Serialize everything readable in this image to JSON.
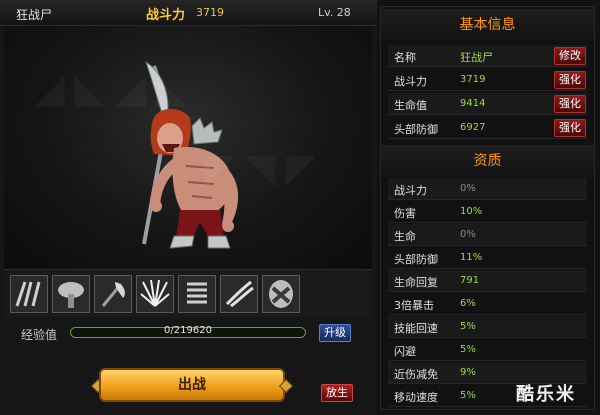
{
  "header": {
    "character_name": "狂战尸",
    "power_label": "战斗力",
    "power_value": "3719",
    "level": "Lv. 28"
  },
  "skills": [
    "skill-claw-icon",
    "skill-mushroom-icon",
    "skill-axe-icon",
    "skill-burst-icon",
    "skill-spring-icon",
    "skill-slash-icon",
    "skill-mask-icon"
  ],
  "experience": {
    "label": "经验值",
    "value": "0/219620",
    "progress": 0.0,
    "upgrade_label": "升级"
  },
  "actions": {
    "fight_label": "出战",
    "release_label": "放生"
  },
  "basic_info": {
    "title": "基本信息",
    "rows": [
      {
        "key": "名称",
        "value": "狂战尸",
        "button": "修改"
      },
      {
        "key": "战斗力",
        "value": "3719",
        "button": "强化"
      },
      {
        "key": "生命值",
        "value": "9414",
        "button": "强化"
      },
      {
        "key": "头部防御",
        "value": "6927",
        "button": "强化"
      }
    ]
  },
  "aptitude": {
    "title": "资质",
    "rows": [
      {
        "key": "战斗力",
        "value": "0%"
      },
      {
        "key": "伤害",
        "value": "10%"
      },
      {
        "key": "生命",
        "value": "0%"
      },
      {
        "key": "头部防御",
        "value": "11%"
      },
      {
        "key": "生命回复",
        "value": "791"
      },
      {
        "key": "3倍暴击",
        "value": "6%"
      },
      {
        "key": "技能回速",
        "value": "5%"
      },
      {
        "key": "闪避",
        "value": "5%"
      },
      {
        "key": "近伤减免",
        "value": "9%"
      },
      {
        "key": "移动速度",
        "value": "5%"
      }
    ]
  },
  "watermark": "酷乐米",
  "colors": {
    "accent": "#ff9900",
    "positive_value": "#9cd84a",
    "button_red": "#8c1c1c",
    "button_blue": "#2f4f9a",
    "fight_gold": "#f0a21c"
  }
}
